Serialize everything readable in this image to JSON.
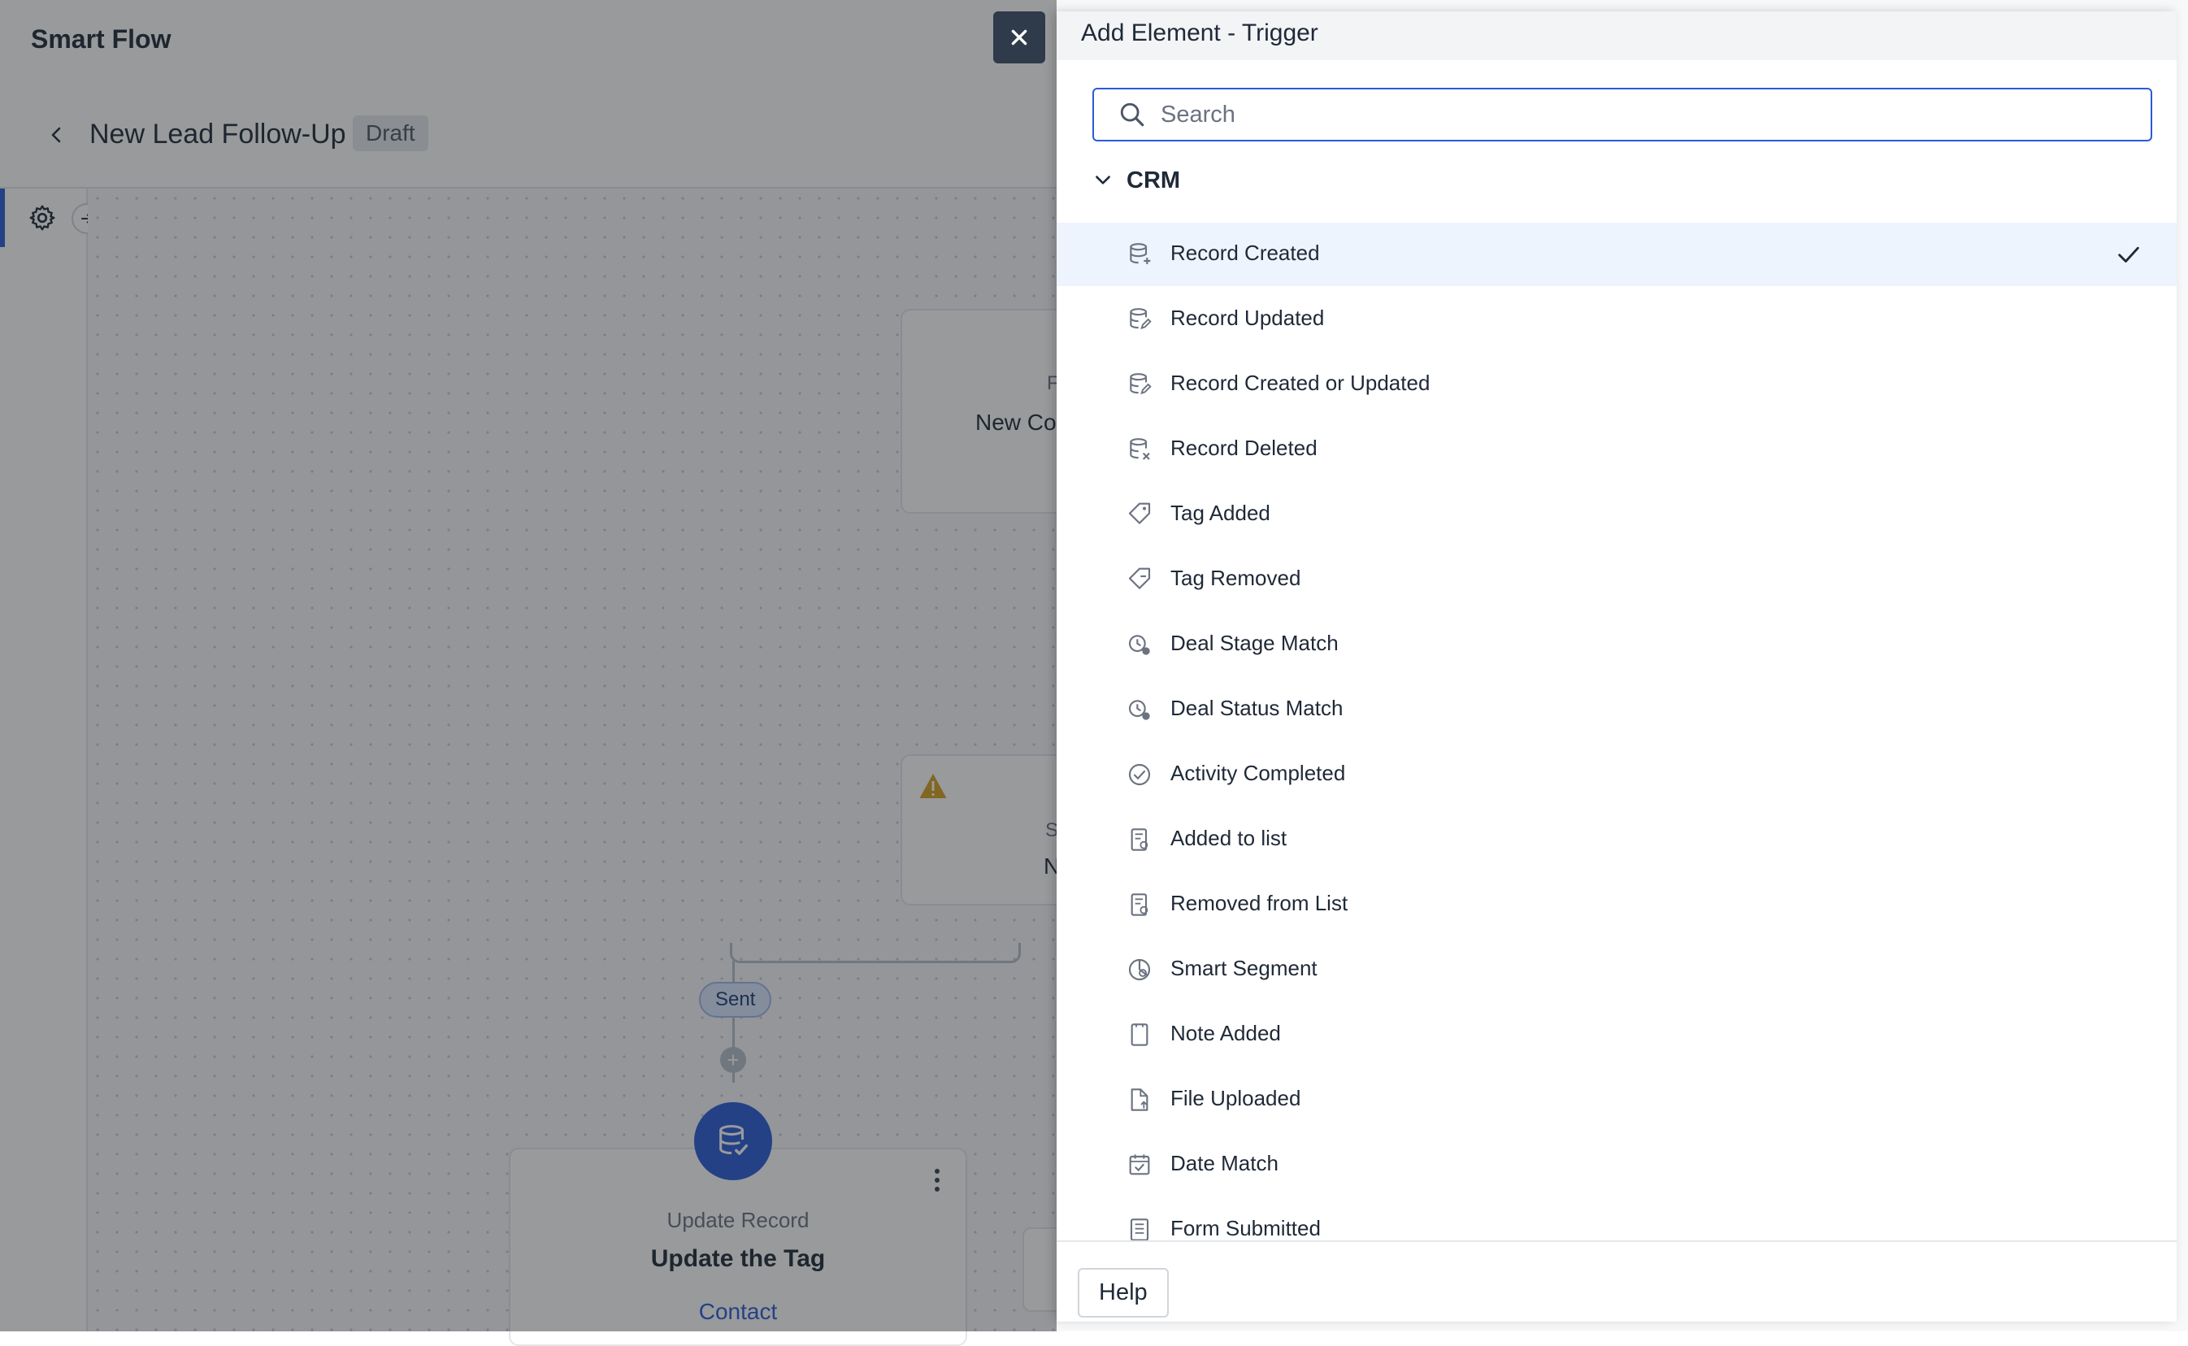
{
  "app": {
    "title": "Smart Flow",
    "flow_name": "New Lead Follow-Up",
    "status_badge": "Draft"
  },
  "canvas": {
    "node1_small": "F",
    "node1_text": "New Co",
    "node2_small": "S",
    "node2_text": "N",
    "connector_label": "Sent",
    "node3": {
      "type": "Update Record",
      "name": "Update the Tag",
      "object": "Contact"
    }
  },
  "panel": {
    "title": "Add Element - Trigger",
    "search": {
      "placeholder": "Search",
      "value": ""
    },
    "category": "CRM",
    "items": [
      {
        "label": "Record Created",
        "icon": "database-plus-icon",
        "selected": true
      },
      {
        "label": "Record Updated",
        "icon": "database-edit-icon",
        "selected": false
      },
      {
        "label": "Record Created or Updated",
        "icon": "database-sync-icon",
        "selected": false
      },
      {
        "label": "Record Deleted",
        "icon": "database-x-icon",
        "selected": false
      },
      {
        "label": "Tag Added",
        "icon": "tag-icon",
        "selected": false
      },
      {
        "label": "Tag Removed",
        "icon": "tag-minus-icon",
        "selected": false
      },
      {
        "label": "Deal Stage Match",
        "icon": "deal-stage-icon",
        "selected": false
      },
      {
        "label": "Deal Status Match",
        "icon": "deal-status-icon",
        "selected": false
      },
      {
        "label": "Activity Completed",
        "icon": "check-circle-icon",
        "selected": false
      },
      {
        "label": "Added to list",
        "icon": "list-add-icon",
        "selected": false
      },
      {
        "label": "Removed from List",
        "icon": "list-remove-icon",
        "selected": false
      },
      {
        "label": "Smart Segment",
        "icon": "segment-icon",
        "selected": false
      },
      {
        "label": "Note Added",
        "icon": "note-icon",
        "selected": false
      },
      {
        "label": "File Uploaded",
        "icon": "file-upload-icon",
        "selected": false
      },
      {
        "label": "Date Match",
        "icon": "calendar-check-icon",
        "selected": false
      },
      {
        "label": "Form Submitted",
        "icon": "form-icon",
        "selected": false
      }
    ],
    "help_label": "Help"
  },
  "colors": {
    "accent": "#2a5bd7",
    "selected_row": "#eef4fe",
    "overlay": "rgba(30,34,40,0.46)"
  }
}
